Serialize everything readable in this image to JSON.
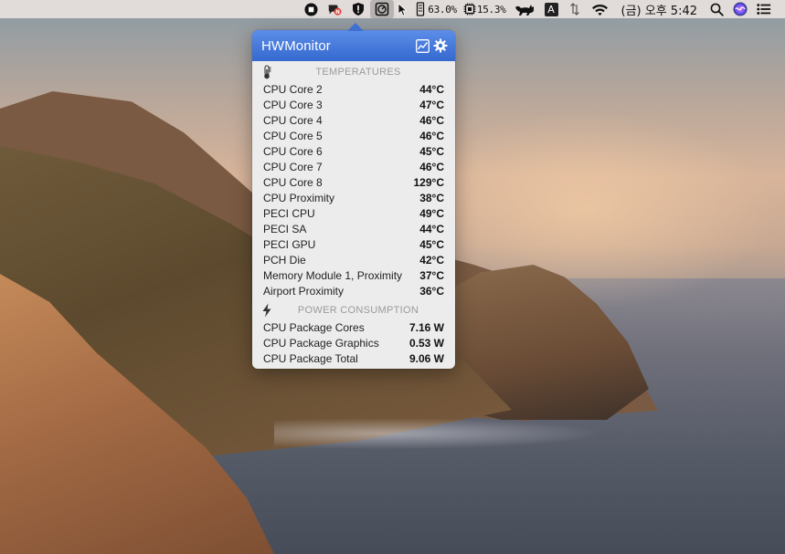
{
  "menubar": {
    "cpu_percent": "63.0%",
    "mem_percent": "15.3%",
    "input_source": "A",
    "clock": "(금) 오후 5:42",
    "icons": [
      "stop-icon",
      "notification-app-icon",
      "shield-icon",
      "hwmonitor-icon",
      "cursor-icon",
      "memory-icon",
      "cpu-chip-icon",
      "cat-icon",
      "input-source-icon",
      "network-arrows-icon",
      "wifi-icon",
      "spotlight-search-icon",
      "siri-icon",
      "control-center-icon"
    ]
  },
  "popover": {
    "title": "HWMonitor",
    "header_icons": [
      "graph-icon",
      "gear-icon"
    ],
    "temperatures": {
      "label": "TEMPERATURES",
      "icon": "thermometer-icon",
      "rows": [
        {
          "name": "CPU Core 2",
          "value": "44°C"
        },
        {
          "name": "CPU Core 3",
          "value": "47°C"
        },
        {
          "name": "CPU Core 4",
          "value": "46°C"
        },
        {
          "name": "CPU Core 5",
          "value": "46°C"
        },
        {
          "name": "CPU Core 6",
          "value": "45°C"
        },
        {
          "name": "CPU Core 7",
          "value": "46°C"
        },
        {
          "name": "CPU Core 8",
          "value": "129°C"
        },
        {
          "name": "CPU Proximity",
          "value": "38°C"
        },
        {
          "name": "PECI CPU",
          "value": "49°C"
        },
        {
          "name": "PECI SA",
          "value": "44°C"
        },
        {
          "name": "PECI GPU",
          "value": "45°C"
        },
        {
          "name": "PCH Die",
          "value": "42°C"
        },
        {
          "name": "Memory Module 1, Proximity",
          "value": "37°C"
        },
        {
          "name": "Airport Proximity",
          "value": "36°C"
        }
      ]
    },
    "power": {
      "label": "POWER CONSUMPTION",
      "icon": "lightning-icon",
      "rows": [
        {
          "name": "CPU Package Cores",
          "value": "7.16 W"
        },
        {
          "name": "CPU Package Graphics",
          "value": "0.53 W"
        },
        {
          "name": "CPU Package Total",
          "value": "9.06 W"
        }
      ]
    }
  }
}
